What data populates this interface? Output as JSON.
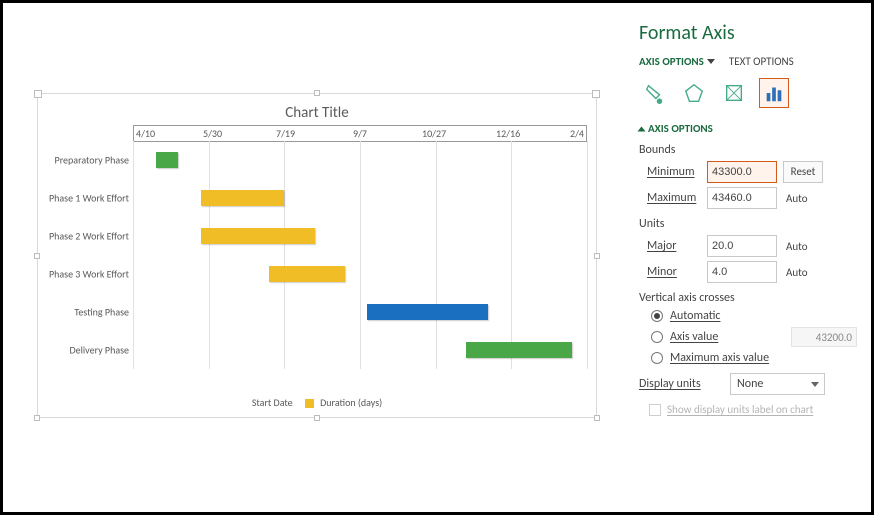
{
  "chart_data": {
    "type": "bar",
    "orientation": "horizontal-gantt",
    "title": "Chart Title",
    "x_axis_dates": [
      "4/10",
      "5/30",
      "7/19",
      "9/7",
      "10/27",
      "12/16",
      "2/4"
    ],
    "x_numeric_range": [
      43200,
      43500
    ],
    "series_legend": [
      "Start Date",
      "Duration (days)"
    ],
    "tasks": [
      {
        "name": "Preparatory Phase",
        "start": 43215,
        "duration": 15,
        "color": "green"
      },
      {
        "name": "Phase 1 Work Effort",
        "start": 43245,
        "duration": 55,
        "color": "yellow"
      },
      {
        "name": "Phase 2 Work Effort",
        "start": 43245,
        "duration": 75,
        "color": "yellow"
      },
      {
        "name": "Phase 3 Work Effort",
        "start": 43290,
        "duration": 50,
        "color": "yellow"
      },
      {
        "name": "Testing Phase",
        "start": 43355,
        "duration": 80,
        "color": "blue"
      },
      {
        "name": "Delivery Phase",
        "start": 43420,
        "duration": 70,
        "color": "green"
      }
    ]
  },
  "panel": {
    "title": "Format Axis",
    "tabs": {
      "axis_options": "AXIS OPTIONS",
      "text_options": "TEXT OPTIONS"
    },
    "icons": {
      "fill": "fill-icon",
      "effects": "pentagon-icon",
      "size": "size-props-icon",
      "bar": "bar-chart-icon"
    },
    "section": "AXIS OPTIONS",
    "bounds_label": "Bounds",
    "min_label": "Minimum",
    "min_value": "43300.0",
    "reset_btn": "Reset",
    "max_label": "Maximum",
    "max_value": "43460.0",
    "auto_txt": "Auto",
    "units_label": "Units",
    "major_label": "Major",
    "major_value": "20.0",
    "minor_label": "Minor",
    "minor_value": "4.0",
    "vac_label": "Vertical axis crosses",
    "vac_auto": "Automatic",
    "vac_axis": "Axis value",
    "vac_axis_value": "43200.0",
    "vac_max": "Maximum axis value",
    "display_units_label": "Display units",
    "display_units_value": "None",
    "show_label_chk": "Show display units label on chart"
  },
  "legend": {
    "start": "Start Date",
    "dur": "Duration (days)"
  },
  "rows": [
    "Preparatory Phase",
    "Phase 1 Work Effort",
    "Phase 2 Work Effort",
    "Phase 3 Work Effort",
    "Testing Phase",
    "Delivery Phase"
  ],
  "xaxis": [
    "4/10",
    "5/30",
    "7/19",
    "9/7",
    "10/27",
    "12/16",
    "2/4"
  ]
}
